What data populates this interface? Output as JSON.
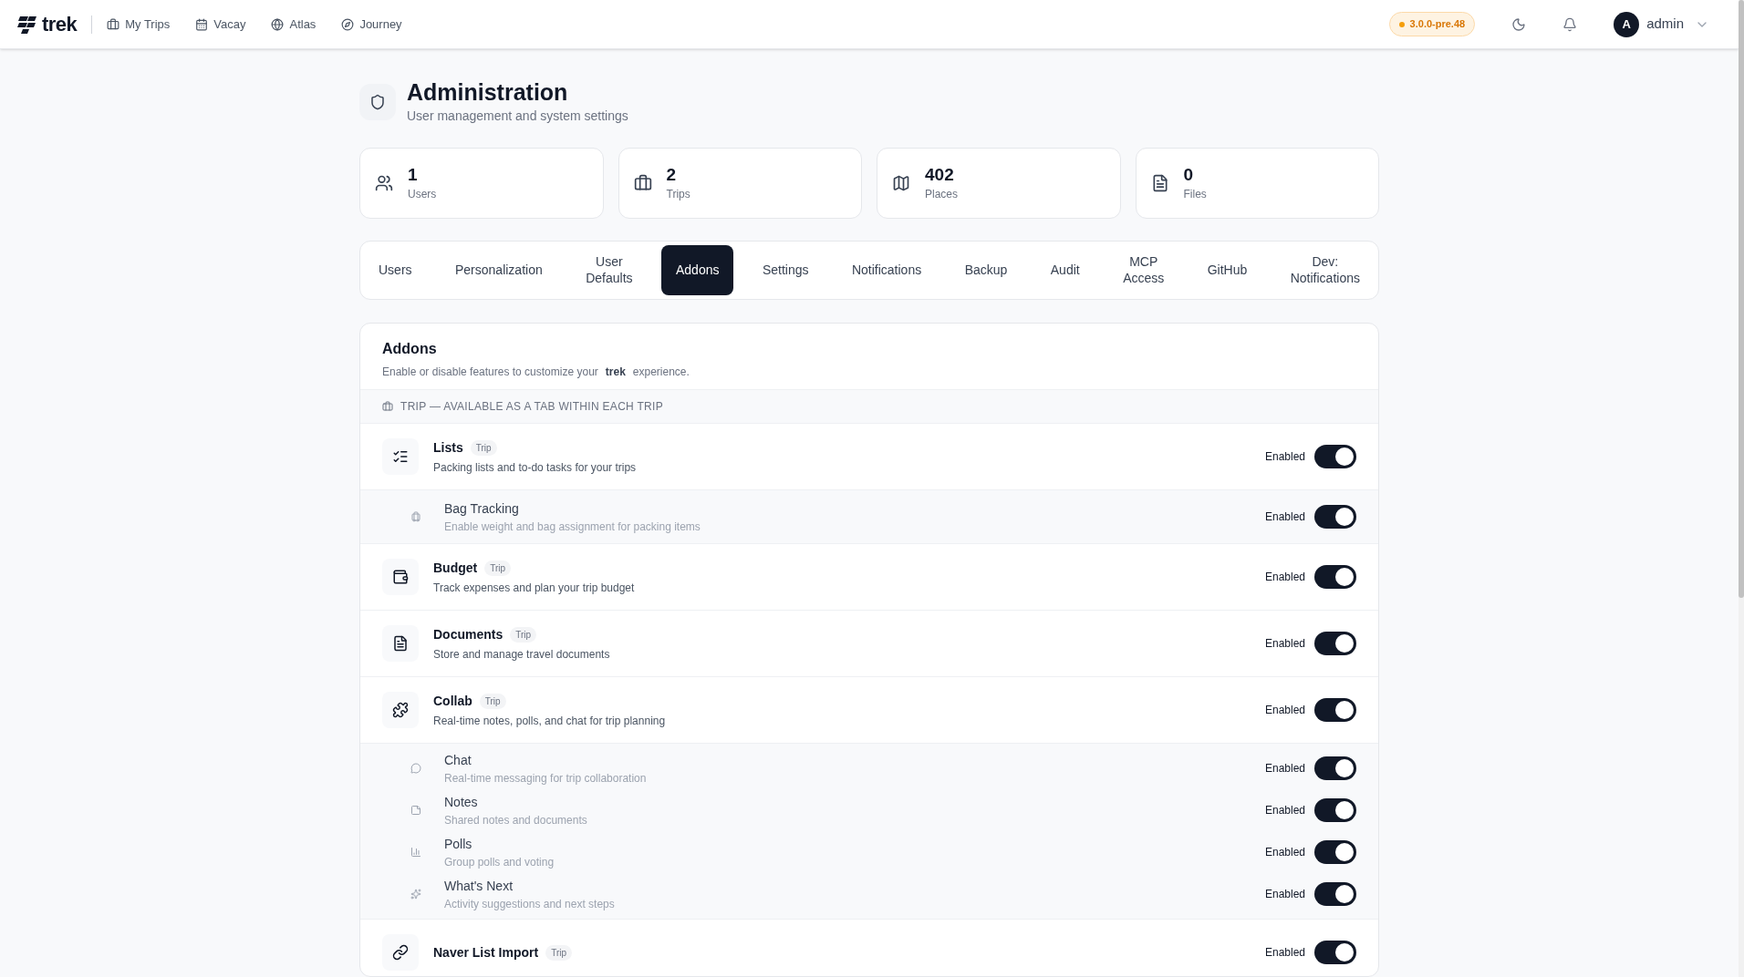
{
  "brand": "trek",
  "nav": [
    {
      "label": "My Trips"
    },
    {
      "label": "Vacay"
    },
    {
      "label": "Atlas"
    },
    {
      "label": "Journey"
    }
  ],
  "version_badge": "3.0.0-pre.48",
  "user": {
    "initial": "A",
    "name": "admin"
  },
  "page": {
    "title": "Administration",
    "subtitle": "User management and system settings"
  },
  "stats": [
    {
      "value": "1",
      "label": "Users"
    },
    {
      "value": "2",
      "label": "Trips"
    },
    {
      "value": "402",
      "label": "Places"
    },
    {
      "value": "0",
      "label": "Files"
    }
  ],
  "tabs": [
    {
      "label": "Users",
      "selected": false
    },
    {
      "label": "Personalization",
      "selected": false
    },
    {
      "label": "User Defaults",
      "selected": false
    },
    {
      "label": "Addons",
      "selected": true
    },
    {
      "label": "Settings",
      "selected": false
    },
    {
      "label": "Notifications",
      "selected": false
    },
    {
      "label": "Backup",
      "selected": false
    },
    {
      "label": "Audit",
      "selected": false
    },
    {
      "label": "MCP Access",
      "selected": false
    },
    {
      "label": "GitHub",
      "selected": false
    },
    {
      "label": "Dev: Notifications",
      "selected": false
    }
  ],
  "addons_panel": {
    "title": "Addons",
    "description_before": "Enable or disable features to customize your",
    "description_logo": "trek",
    "description_after": "experience.",
    "section": "TRIP — AVAILABLE AS A TAB WITHIN EACH TRIP",
    "items": [
      {
        "kind": "main",
        "name": "Lists",
        "tag": "Trip",
        "description": "Packing lists and to-do tasks for your trips",
        "status": "Enabled",
        "on": true,
        "children": [
          {
            "name": "Bag Tracking",
            "description": "Enable weight and bag assignment for packing items",
            "status": "Enabled",
            "on": true
          }
        ]
      },
      {
        "kind": "main",
        "name": "Budget",
        "tag": "Trip",
        "description": "Track expenses and plan your trip budget",
        "status": "Enabled",
        "on": true
      },
      {
        "kind": "main",
        "name": "Documents",
        "tag": "Trip",
        "description": "Store and manage travel documents",
        "status": "Enabled",
        "on": true
      },
      {
        "kind": "main",
        "name": "Collab",
        "tag": "Trip",
        "description": "Real-time notes, polls, and chat for trip planning",
        "status": "Enabled",
        "on": true,
        "children": [
          {
            "name": "Chat",
            "description": "Real-time messaging for trip collaboration",
            "status": "Enabled",
            "on": true
          },
          {
            "name": "Notes",
            "description": "Shared notes and documents",
            "status": "Enabled",
            "on": true
          },
          {
            "name": "Polls",
            "description": "Group polls and voting",
            "status": "Enabled",
            "on": true
          },
          {
            "name": "What's Next",
            "description": "Activity suggestions and next steps",
            "status": "Enabled",
            "on": true
          }
        ]
      },
      {
        "kind": "main",
        "name": "Naver List Import",
        "tag": "Trip",
        "status": "Enabled",
        "on": true
      }
    ]
  }
}
